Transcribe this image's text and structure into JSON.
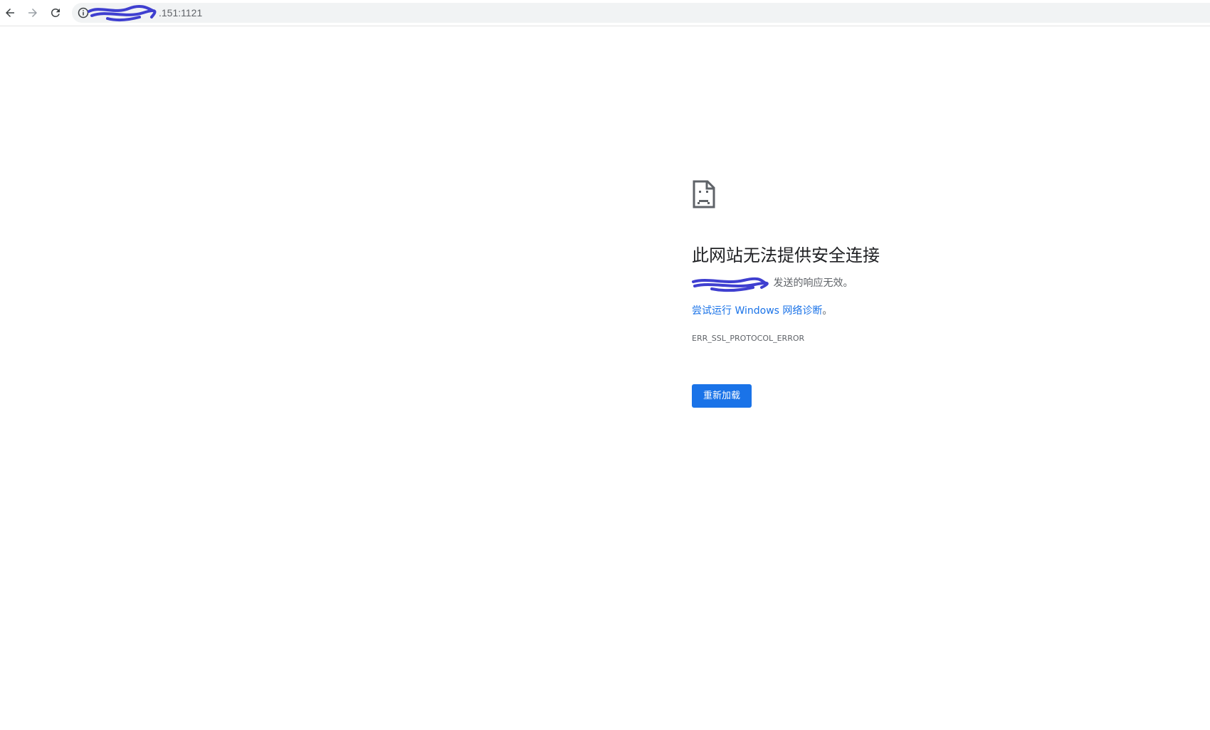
{
  "browser": {
    "back_icon": "arrow-left-icon",
    "forward_icon": "arrow-right-icon",
    "reload_icon": "reload-icon",
    "site_info_icon": "info-icon",
    "url_visible": ".151:1121"
  },
  "error_page": {
    "icon": "sad-document-icon",
    "heading": "此网站无法提供安全连接",
    "description_suffix": "发送的响应无效。",
    "suggestion_link": "尝试运行 Windows 网络诊断",
    "suggestion_tail": "。",
    "error_code": "ERR_SSL_PROTOCOL_ERROR",
    "reload_label": "重新加载"
  },
  "colors": {
    "accent": "#1a73e8",
    "heading": "#202124",
    "secondary_text": "#5f6368",
    "omnibox_bg": "#f1f3f4",
    "redaction": "#3f3fd0"
  }
}
